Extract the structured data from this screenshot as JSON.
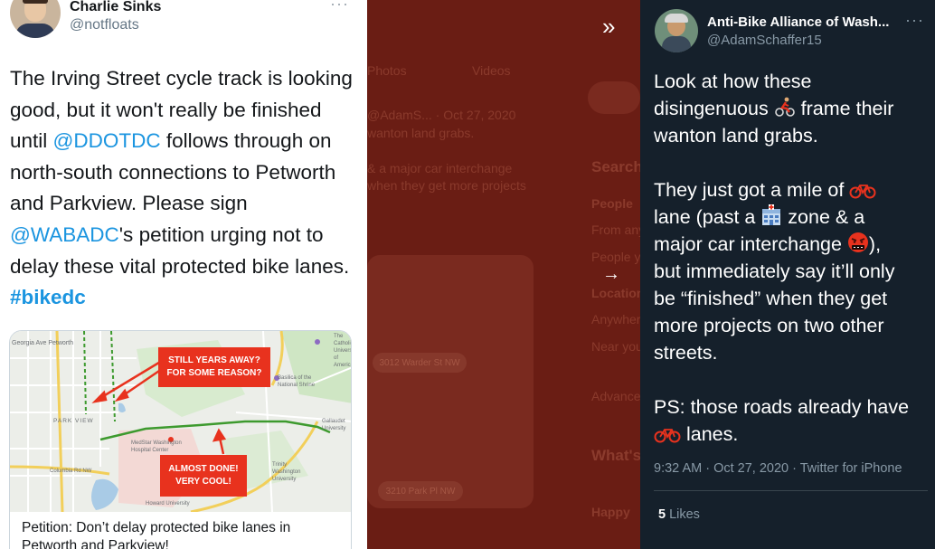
{
  "left_tweet": {
    "author_name": "Charlie Sinks",
    "author_handle": "@notfloats",
    "more_label": "···",
    "text": {
      "p1": "The Irving Street cycle track is looking good, but it won't really be finished until ",
      "mention1": "@DDOTDC",
      "p2": " follows through on north-south connections to Petworth and Parkview. Please sign ",
      "mention2": "@WABADC",
      "p3": "'s petition urging not to delay these vital protected bike lanes. ",
      "hashtag": "#bikedc"
    },
    "card": {
      "callout_top_line1": "STILL YEARS AWAY?",
      "callout_top_line2": "FOR SOME REASON?",
      "callout_bottom_line1": "ALMOST DONE!",
      "callout_bottom_line2": "VERY COOL!",
      "map_labels": {
        "park_view": "PARK VIEW",
        "georgia": "Georgia Ave Petworth",
        "catholic_u": "The Catholic University of America",
        "hospital": "MedStar Washington Hospital Center",
        "basilica": "Basilica of the National Shrine",
        "trinity": "Trinity Washington University",
        "columbia": "Columbia Rd NW",
        "gallaudet": "Gallaudet University",
        "howard": "Howard University"
      },
      "title": "Petition: Don’t delay protected bike lanes in Petworth and Parkview!"
    }
  },
  "background": {
    "tab_photos": "Photos",
    "tab_videos": "Videos",
    "tweet_meta": "@AdamS... · Oct 27, 2020",
    "tweet_line1": "wanton land grabs.",
    "tweet_line2": "& a major car interchange",
    "tweet_line3": "when they get more projects",
    "search_header": "Search",
    "people": "People",
    "from_anyone": "From anyone",
    "people_you_follow": "People you follow",
    "location": "Location",
    "anywhere": "Anywhere",
    "near_you": "Near you",
    "advanced": "Advanced search",
    "whats_happening": "What's happening",
    "happy": "Happy",
    "pill1": "3012 Warder St NW",
    "pill2": "3210 Park Pl NW",
    "nav_prev": "»",
    "nav_next": "→"
  },
  "right_tweet": {
    "author_name": "Anti-Bike Alliance of Wash...",
    "author_handle": "@AdamSchaffer15",
    "more_label": "···",
    "line1": "Look at how these",
    "line2a": "disingenuous ",
    "line2b": " frame their",
    "line3": "wanton land grabs.",
    "line4a": "They just got a mile of ",
    "line5a": "lane (past a ",
    "line5b": " zone & a",
    "line6a": "major car interchange ",
    "line6b": "),",
    "line7": "but immediately say it’ll only",
    "line8": "be “finished” when they get",
    "line9": "more projects on two other",
    "line10": "streets.",
    "line11": "PS: those roads already have",
    "line12b": " lanes.",
    "icons": [
      "cyclist-emoji-icon",
      "bicycle-emoji-icon",
      "hospital-emoji-icon",
      "angry-face-emoji-icon"
    ],
    "timestamp": "9:32 AM · Oct 27, 2020 · Twitter for iPhone",
    "likes_count": "5",
    "likes_label": "Likes"
  },
  "colors": {
    "link_blue": "#1b95e0",
    "dark_bg": "#15202b",
    "overlay_red": "#6a1d14",
    "callout_red": "#e8321e"
  }
}
